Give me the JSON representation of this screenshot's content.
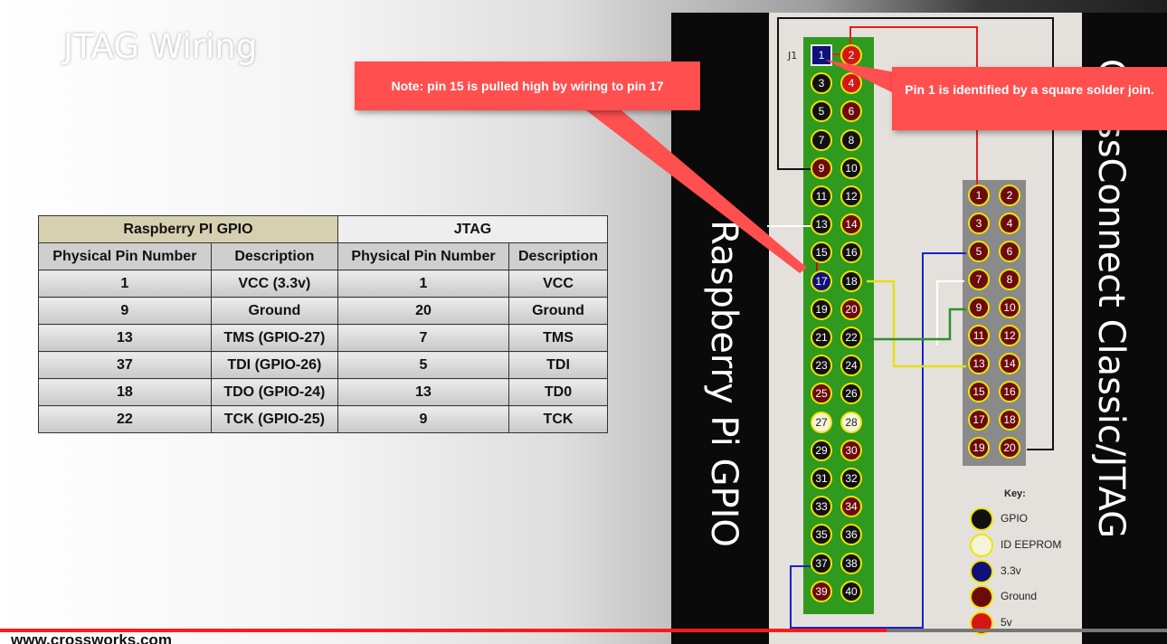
{
  "slide": {
    "title": "JTAG Wiring"
  },
  "table": {
    "group_headers": [
      "Raspberry PI GPIO",
      "JTAG"
    ],
    "sub_headers": [
      "Physical Pin Number",
      "Description",
      "Physical Pin Number",
      "Description"
    ],
    "rows": [
      [
        "1",
        "VCC (3.3v)",
        "1",
        "VCC"
      ],
      [
        "9",
        "Ground",
        "20",
        "Ground"
      ],
      [
        "13",
        "TMS (GPIO-27)",
        "7",
        "TMS"
      ],
      [
        "37",
        "TDI (GPIO-26)",
        "5",
        "TDI"
      ],
      [
        "18",
        "TDO (GPIO-24)",
        "13",
        "TD0"
      ],
      [
        "22",
        "TCK (GPIO-25)",
        "9",
        "TCK"
      ]
    ]
  },
  "diagram": {
    "rpi_label": "Raspberry Pi GPIO",
    "cc_label": "CrossConnect Classic/JTAG",
    "j1_label": "J1",
    "gpio_pins": [
      {
        "n": "1",
        "type": "3v3"
      },
      {
        "n": "2",
        "type": "5v"
      },
      {
        "n": "3",
        "type": "gpio"
      },
      {
        "n": "4",
        "type": "5v"
      },
      {
        "n": "5",
        "type": "gpio"
      },
      {
        "n": "6",
        "type": "ground"
      },
      {
        "n": "7",
        "type": "gpio"
      },
      {
        "n": "8",
        "type": "gpio"
      },
      {
        "n": "9",
        "type": "ground"
      },
      {
        "n": "10",
        "type": "gpio"
      },
      {
        "n": "11",
        "type": "gpio"
      },
      {
        "n": "12",
        "type": "gpio"
      },
      {
        "n": "13",
        "type": "gpio"
      },
      {
        "n": "14",
        "type": "ground"
      },
      {
        "n": "15",
        "type": "gpio"
      },
      {
        "n": "16",
        "type": "gpio"
      },
      {
        "n": "17",
        "type": "3v3"
      },
      {
        "n": "18",
        "type": "gpio"
      },
      {
        "n": "19",
        "type": "gpio"
      },
      {
        "n": "20",
        "type": "ground"
      },
      {
        "n": "21",
        "type": "gpio"
      },
      {
        "n": "22",
        "type": "gpio"
      },
      {
        "n": "23",
        "type": "gpio"
      },
      {
        "n": "24",
        "type": "gpio"
      },
      {
        "n": "25",
        "type": "ground"
      },
      {
        "n": "26",
        "type": "gpio"
      },
      {
        "n": "27",
        "type": "eeprom"
      },
      {
        "n": "28",
        "type": "eeprom"
      },
      {
        "n": "29",
        "type": "gpio"
      },
      {
        "n": "30",
        "type": "ground"
      },
      {
        "n": "31",
        "type": "gpio"
      },
      {
        "n": "32",
        "type": "gpio"
      },
      {
        "n": "33",
        "type": "gpio"
      },
      {
        "n": "34",
        "type": "ground"
      },
      {
        "n": "35",
        "type": "gpio"
      },
      {
        "n": "36",
        "type": "gpio"
      },
      {
        "n": "37",
        "type": "gpio"
      },
      {
        "n": "38",
        "type": "gpio"
      },
      {
        "n": "39",
        "type": "ground"
      },
      {
        "n": "40",
        "type": "gpio"
      }
    ],
    "jtag_pins": [
      "1",
      "2",
      "3",
      "4",
      "5",
      "6",
      "7",
      "8",
      "9",
      "10",
      "11",
      "12",
      "13",
      "14",
      "15",
      "16",
      "17",
      "18",
      "19",
      "20"
    ],
    "key": {
      "title": "Key:",
      "items": [
        {
          "label": "GPIO",
          "color": "#111111"
        },
        {
          "label": "ID EEPROM",
          "color": "#f4f4dc"
        },
        {
          "label": "3.3v",
          "color": "#10107a"
        },
        {
          "label": "Ground",
          "color": "#6b0b0b"
        },
        {
          "label": "5v",
          "color": "#d41616"
        }
      ]
    },
    "pin_colors": {
      "gpio": "#111111",
      "5v": "#d41616",
      "ground": "#6b0b0b",
      "3v3": "#10107a",
      "eeprom": "#f4f4dc"
    }
  },
  "callouts": {
    "note": "Note: pin 15 is pulled high by wiring to pin 17",
    "pin1": "Pin 1 is identified by a square solder join."
  },
  "player": {
    "progress": 0.76
  },
  "footer": {
    "url": "www.crossworks.com"
  }
}
